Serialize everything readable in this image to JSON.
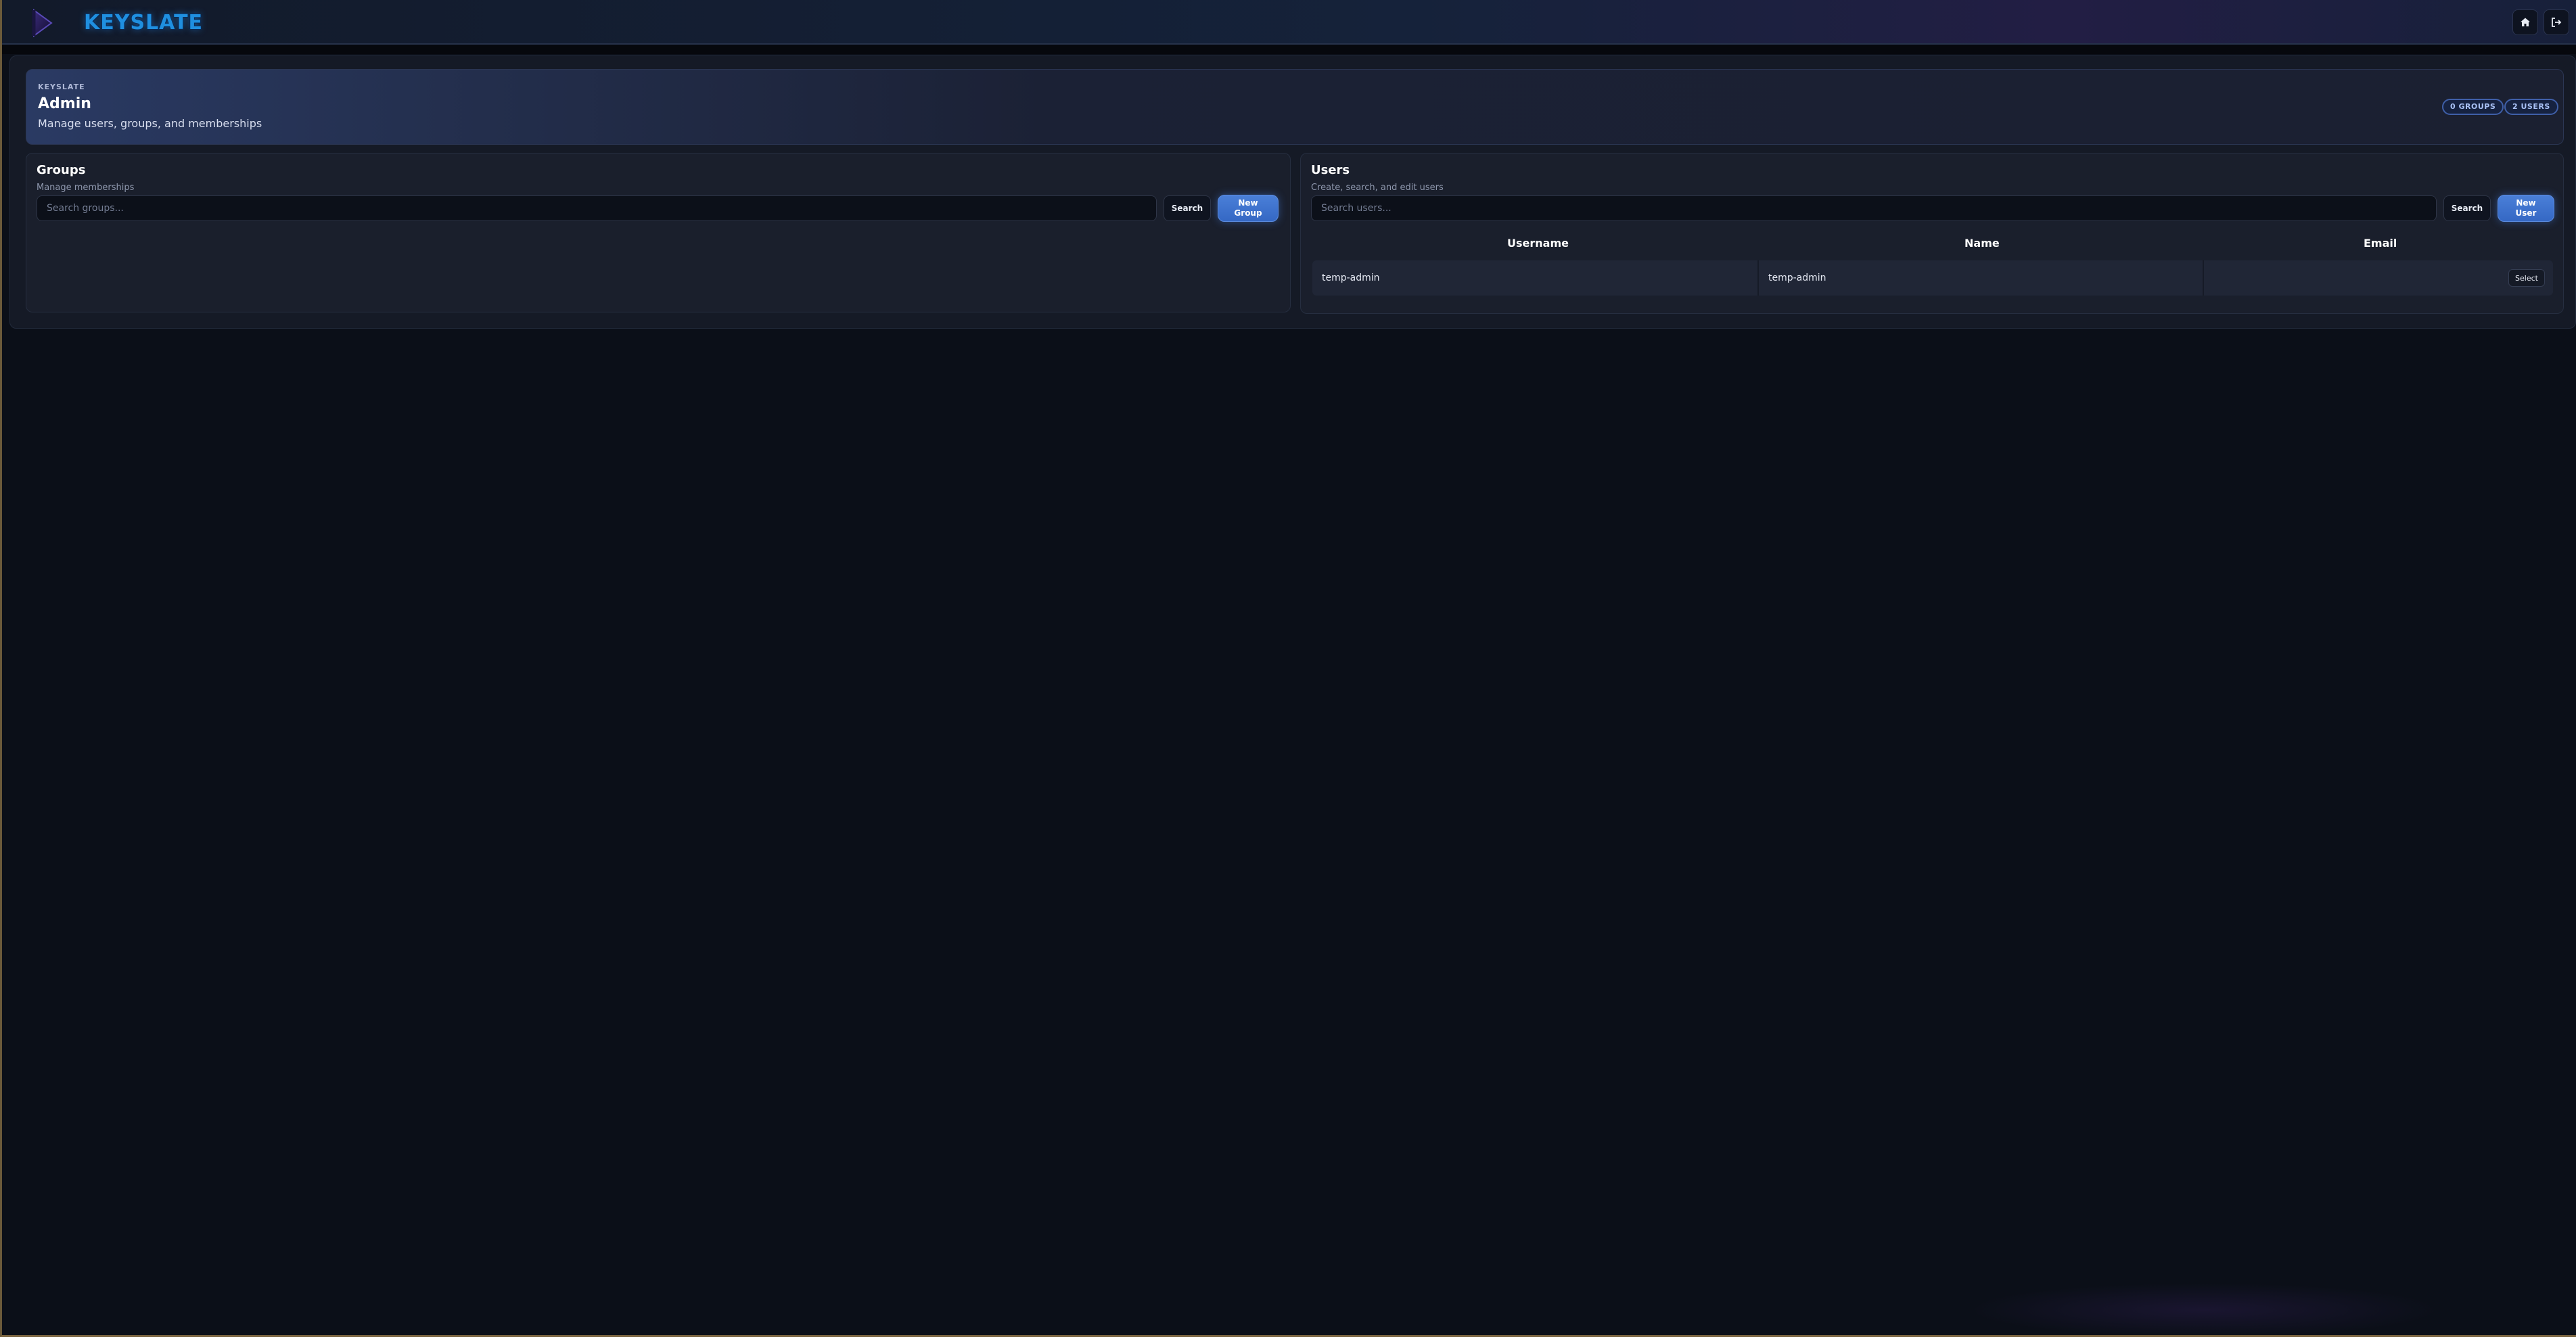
{
  "header": {
    "brand": "KEYSLATE",
    "icons": [
      "play-logo-icon",
      "home-icon",
      "logout-icon"
    ]
  },
  "hero": {
    "kicker": "KEYSLATE",
    "title": "Admin",
    "subtitle": "Manage users, groups, and memberships",
    "groups_count": "0 GROUPS",
    "users_count": "2 USERS"
  },
  "groups_panel": {
    "title": "Groups",
    "subtitle": "Manage memberships",
    "search_placeholder": "Search groups...",
    "search_label": "Search",
    "new_line1": "New",
    "new_line2": "Group"
  },
  "users_panel": {
    "title": "Users",
    "subtitle": "Create, search, and edit users",
    "search_placeholder": "Search users...",
    "search_label": "Search",
    "new_line1": "New",
    "new_line2": "User",
    "columns": [
      "Username",
      "Name",
      "Email"
    ],
    "rows": [
      {
        "username": "temp-admin",
        "name": "temp-admin",
        "email": "",
        "action": "Select"
      }
    ]
  },
  "colors": {
    "accent": "#3f72cf",
    "brand": "#1f8fe0",
    "background": "#0b0f18"
  }
}
